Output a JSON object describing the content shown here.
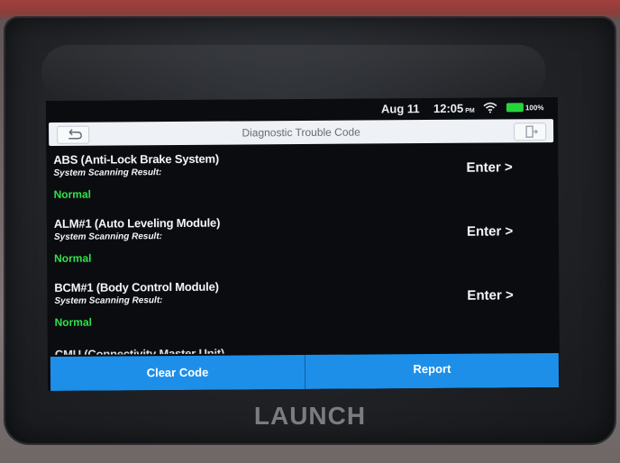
{
  "status_bar": {
    "date": "Aug 11",
    "time": "12:05",
    "ampm": "PM",
    "battery": "100%",
    "wifi_icon": "wifi-icon",
    "battery_icon": "battery-icon"
  },
  "header": {
    "title": "Diagnostic Trouble Code",
    "back_icon": "back-arrow-icon",
    "exit_icon": "exit-icon"
  },
  "systems": [
    {
      "name": "ABS (Anti-Lock Brake System)",
      "result_label": "System Scanning Result:",
      "result": "Normal",
      "action": "Enter >"
    },
    {
      "name": "ALM#1 (Auto Leveling Module)",
      "result_label": "System Scanning Result:",
      "result": "Normal",
      "action": "Enter >"
    },
    {
      "name": "BCM#1 (Body Control Module)",
      "result_label": "System Scanning Result:",
      "result": "Normal",
      "action": "Enter >"
    },
    {
      "name": "CMU (Connectivity Master Unit)"
    }
  ],
  "footer": {
    "clear_code": "Clear Code",
    "report": "Report"
  },
  "brand": "LAUNCH",
  "colors": {
    "accent": "#1e8fe8",
    "normal_status": "#2fe24a",
    "screen_bg": "#0b0c0f"
  }
}
